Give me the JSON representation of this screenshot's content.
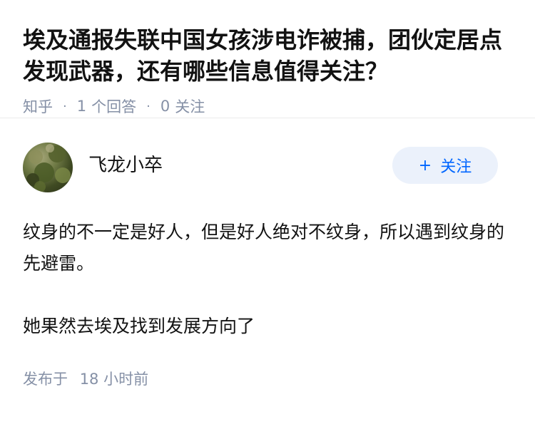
{
  "question": {
    "title": "埃及通报失联中国女孩涉电诈被捕，团伙定居点发现武器，还有哪些信息值得关注？",
    "site": "知乎",
    "separator": "·",
    "answer_count": "1",
    "answer_label": "个回答",
    "follower_count": "0",
    "follower_label": "关注"
  },
  "answer": {
    "author_name": "飞龙小卒",
    "follow_plus": "+",
    "follow_label": "关注",
    "paragraphs": [
      "纹身的不一定是好人，但是好人绝对不纹身，所以遇到纹身的先避雷。",
      "她果然去埃及找到发展方向了"
    ],
    "published_label": "发布于",
    "published_time": "18 小时前"
  },
  "colors": {
    "meta_text": "#8590a6",
    "follow_bg": "#ebf1fb",
    "follow_text": "#0066ff",
    "divider": "#ebebeb"
  }
}
